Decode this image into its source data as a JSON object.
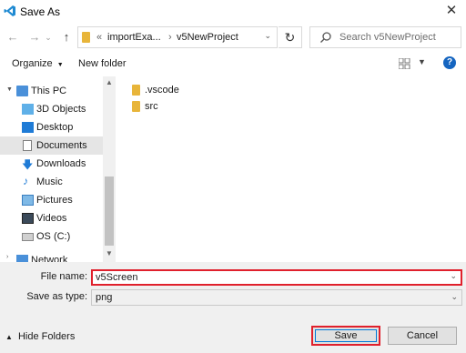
{
  "window": {
    "title": "Save As",
    "close": "✕"
  },
  "nav": {
    "breadcrumb": [
      "«",
      "importExa...",
      "›",
      "v5NewProject"
    ],
    "search_placeholder": "Search v5NewProject"
  },
  "toolbar": {
    "organize": "Organize",
    "new_folder": "New folder"
  },
  "sidebar": {
    "items": [
      {
        "label": "This PC",
        "icon": "computer-icon"
      },
      {
        "label": "3D Objects",
        "icon": "cube-icon"
      },
      {
        "label": "Desktop",
        "icon": "desktop-icon"
      },
      {
        "label": "Documents",
        "icon": "document-icon",
        "selected": true
      },
      {
        "label": "Downloads",
        "icon": "download-icon"
      },
      {
        "label": "Music",
        "icon": "music-icon"
      },
      {
        "label": "Pictures",
        "icon": "picture-icon"
      },
      {
        "label": "Videos",
        "icon": "video-icon"
      },
      {
        "label": "OS (C:)",
        "icon": "drive-icon"
      },
      {
        "label": "Network",
        "icon": "network-icon"
      }
    ]
  },
  "files": [
    {
      "name": ".vscode"
    },
    {
      "name": "src"
    }
  ],
  "form": {
    "file_name_label": "File name:",
    "file_name_value": "v5Screen",
    "save_type_label": "Save as type:",
    "save_type_value": "png"
  },
  "footer": {
    "hide_folders": "Hide Folders",
    "save": "Save",
    "cancel": "Cancel"
  },
  "colors": {
    "highlight": "#e0202c",
    "selected": "#e5e5e5",
    "folder": "#e8b53a",
    "accent": "#0078d7"
  }
}
